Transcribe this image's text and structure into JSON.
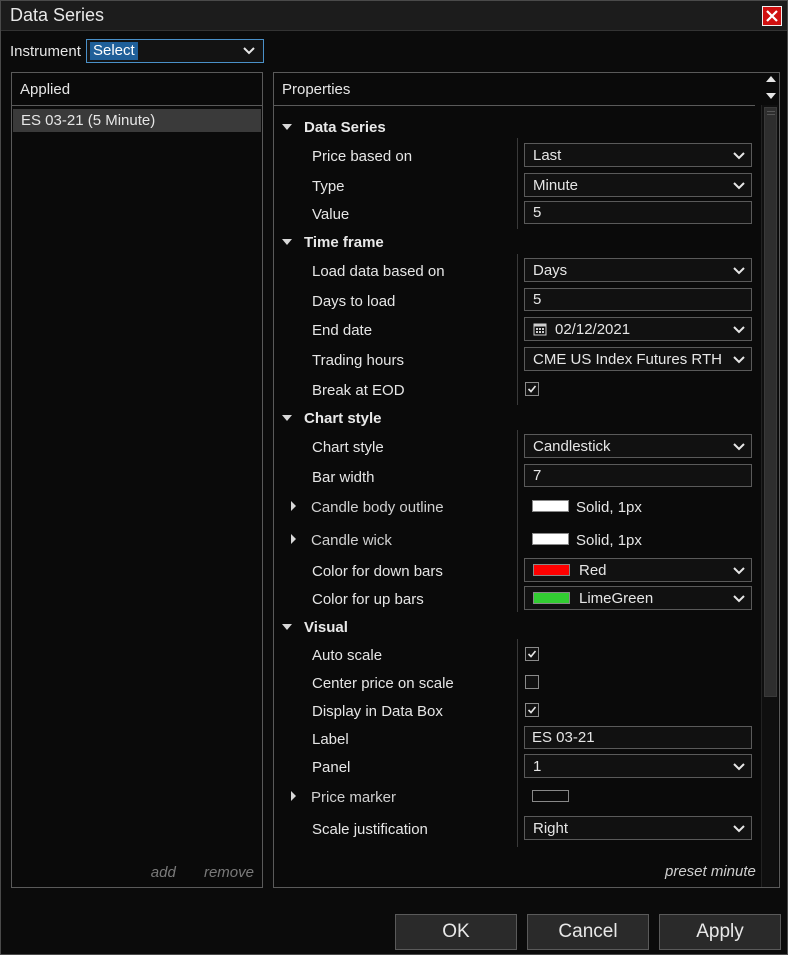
{
  "window": {
    "title": "Data Series"
  },
  "instrument": {
    "label": "Instrument",
    "value": "Select"
  },
  "applied": {
    "header": "Applied",
    "items": [
      "ES 03-21 (5 Minute)"
    ],
    "add_label": "add",
    "remove_label": "remove"
  },
  "properties": {
    "header": "Properties",
    "preset_label": "preset minute",
    "sections": {
      "data_series": {
        "title": "Data Series",
        "price_based_on": {
          "label": "Price based on",
          "value": "Last"
        },
        "type": {
          "label": "Type",
          "value": "Minute"
        },
        "value": {
          "label": "Value",
          "value": "5"
        }
      },
      "time_frame": {
        "title": "Time frame",
        "load_data_based_on": {
          "label": "Load data based on",
          "value": "Days"
        },
        "days_to_load": {
          "label": "Days to load",
          "value": "5"
        },
        "end_date": {
          "label": "End date",
          "value": "02/12/2021"
        },
        "trading_hours": {
          "label": "Trading hours",
          "value": "CME US Index Futures RTH"
        },
        "break_at_eod": {
          "label": "Break at EOD",
          "checked": true
        }
      },
      "chart_style": {
        "title": "Chart style",
        "chart_style": {
          "label": "Chart style",
          "value": "Candlestick"
        },
        "bar_width": {
          "label": "Bar width",
          "value": "7"
        },
        "candle_body_outline": {
          "label": "Candle body outline",
          "value": "Solid, 1px",
          "color": "#ffffff"
        },
        "candle_wick": {
          "label": "Candle wick",
          "value": "Solid, 1px",
          "color": "#ffffff"
        },
        "color_down": {
          "label": "Color for down bars",
          "value": "Red",
          "color": "#ff0000"
        },
        "color_up": {
          "label": "Color for up bars",
          "value": "LimeGreen",
          "color": "#32cd32"
        }
      },
      "visual": {
        "title": "Visual",
        "auto_scale": {
          "label": "Auto scale",
          "checked": true
        },
        "center_price": {
          "label": "Center price on scale",
          "checked": false
        },
        "display_data_box": {
          "label": "Display in Data Box",
          "checked": true
        },
        "label": {
          "label": "Label",
          "value": "ES 03-21"
        },
        "panel": {
          "label": "Panel",
          "value": "1"
        },
        "price_marker": {
          "label": "Price marker",
          "color": "#0a0a0a"
        },
        "scale_justification": {
          "label": "Scale justification",
          "value": "Right"
        }
      }
    }
  },
  "buttons": {
    "ok": "OK",
    "cancel": "Cancel",
    "apply": "Apply"
  }
}
